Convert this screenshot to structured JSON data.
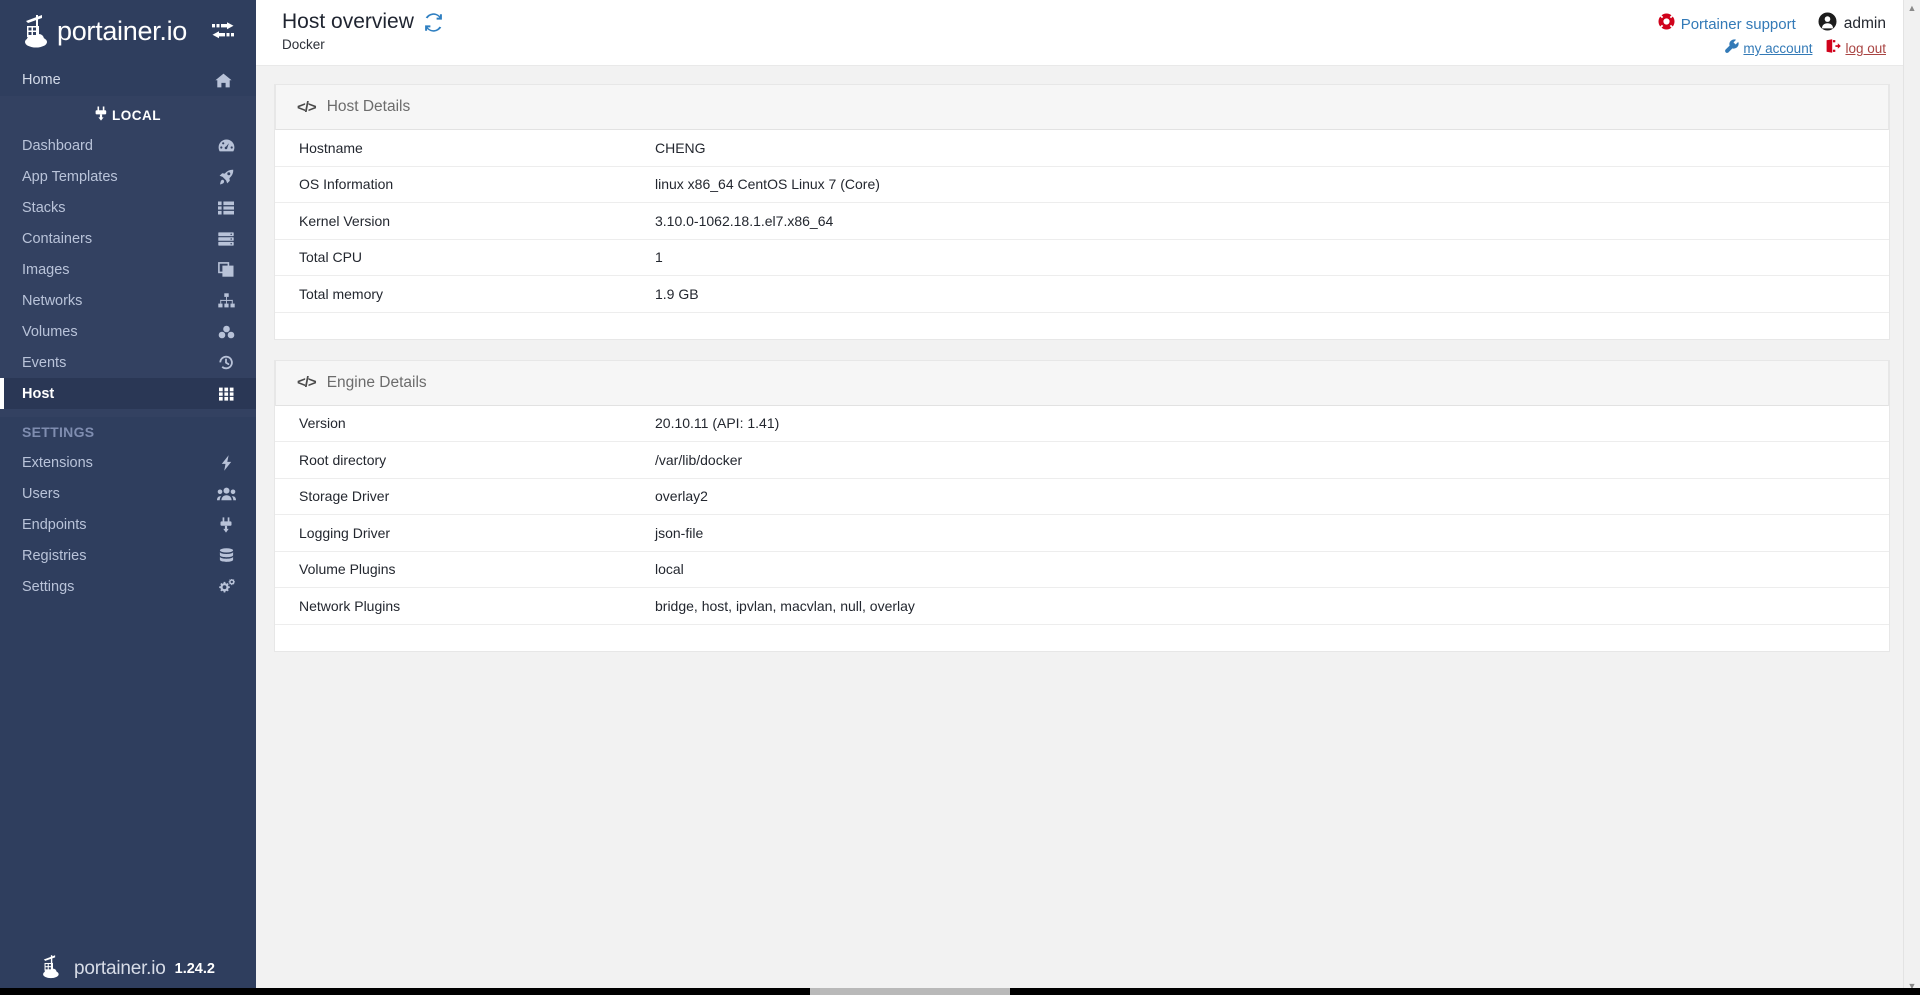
{
  "brand": {
    "name": "portainer.io",
    "version": "1.24.2"
  },
  "sidebar": {
    "toggle_icon": "exchange-arrows-icon",
    "home": {
      "label": "Home",
      "icon": "home-icon"
    },
    "local_section": {
      "label": "LOCAL",
      "icon": "plug-icon"
    },
    "items": [
      {
        "label": "Dashboard",
        "icon": "tachometer-icon"
      },
      {
        "label": "App Templates",
        "icon": "rocket-icon"
      },
      {
        "label": "Stacks",
        "icon": "list-icon"
      },
      {
        "label": "Containers",
        "icon": "server-icon"
      },
      {
        "label": "Images",
        "icon": "clone-icon"
      },
      {
        "label": "Networks",
        "icon": "sitemap-icon"
      },
      {
        "label": "Volumes",
        "icon": "cubes-icon"
      },
      {
        "label": "Events",
        "icon": "history-icon"
      },
      {
        "label": "Host",
        "icon": "grid-icon",
        "active": true
      }
    ],
    "settings_label": "SETTINGS",
    "settings_items": [
      {
        "label": "Extensions",
        "icon": "bolt-icon"
      },
      {
        "label": "Users",
        "icon": "users-icon"
      },
      {
        "label": "Endpoints",
        "icon": "plug-icon"
      },
      {
        "label": "Registries",
        "icon": "database-icon"
      },
      {
        "label": "Settings",
        "icon": "cogs-icon"
      }
    ]
  },
  "topbar": {
    "title": "Host overview",
    "refresh_icon": "refresh-icon",
    "subtitle": "Docker",
    "support_label": "Portainer support",
    "support_icon": "lifebuoy-icon",
    "user_name": "admin",
    "user_icon": "user-circle-icon",
    "my_account_label": "my account",
    "my_account_icon": "wrench-icon",
    "logout_label": "log out",
    "logout_icon": "sign-out-icon"
  },
  "panels": [
    {
      "title": "Host Details",
      "icon": "code-icon",
      "rows": [
        {
          "key": "Hostname",
          "value": "CHENG"
        },
        {
          "key": "OS Information",
          "value": "linux x86_64 CentOS Linux 7 (Core)"
        },
        {
          "key": "Kernel Version",
          "value": "3.10.0-1062.18.1.el7.x86_64"
        },
        {
          "key": "Total CPU",
          "value": "1"
        },
        {
          "key": "Total memory",
          "value": "1.9 GB"
        }
      ]
    },
    {
      "title": "Engine Details",
      "icon": "code-icon",
      "rows": [
        {
          "key": "Version",
          "value": "20.10.11 (API: 1.41)"
        },
        {
          "key": "Root directory",
          "value": "/var/lib/docker"
        },
        {
          "key": "Storage Driver",
          "value": "overlay2"
        },
        {
          "key": "Logging Driver",
          "value": "json-file"
        },
        {
          "key": "Volume Plugins",
          "value": "local"
        },
        {
          "key": "Network Plugins",
          "value": "bridge, host, ipvlan, macvlan, null, overlay"
        }
      ]
    }
  ],
  "colors": {
    "sidebar_bg": "#2f3e5e",
    "sidebar_group_bg": "#334161",
    "active_bg": "#2a3755",
    "link_blue": "#337ab7",
    "logout_red": "#a94442",
    "content_bg": "#f2f2f2"
  }
}
